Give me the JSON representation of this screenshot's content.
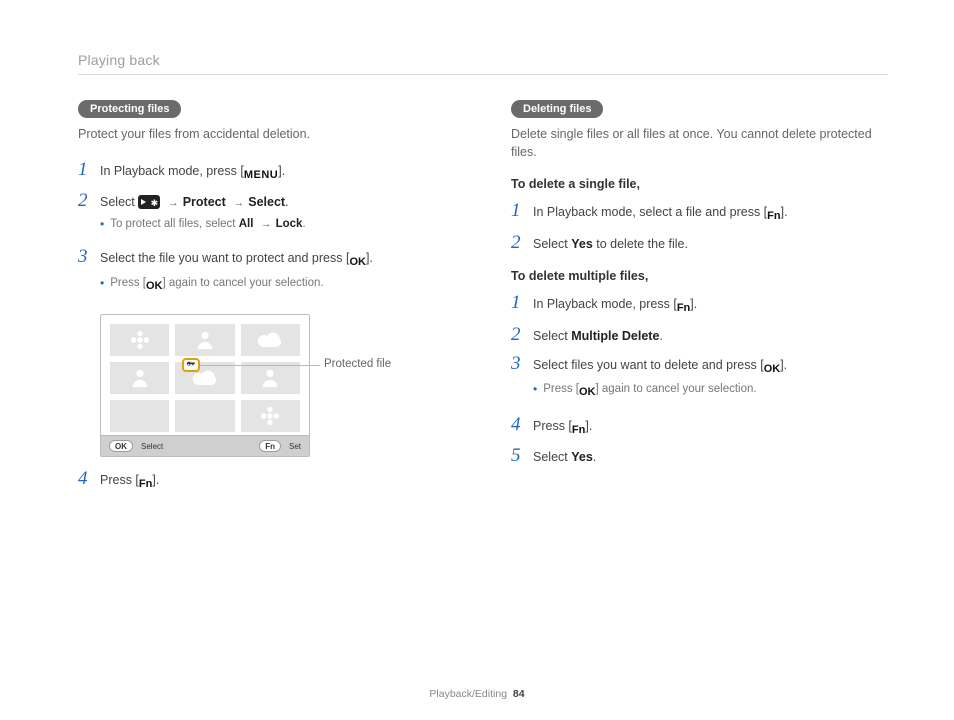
{
  "header": {
    "title": "Playing back"
  },
  "footer": {
    "section": "Playback/Editing",
    "page": "84"
  },
  "left": {
    "pill": "Protecting files",
    "intro": "Protect your files from accidental deletion.",
    "steps": [
      {
        "num": "1",
        "pre": "In Playback mode, press [",
        "icon": "MENU",
        "post": "]."
      },
      {
        "num": "2",
        "pre": "Select ",
        "icon": "video-gear",
        "chain1": "Protect",
        "chain2": "Select",
        "post": ".",
        "bullets": [
          {
            "pre": "To protect all files, select ",
            "b1": "All",
            "b2": "Lock",
            "post": "."
          }
        ]
      },
      {
        "num": "3",
        "pre": "Select the file you want to protect and press [",
        "icon": "OK",
        "post": "].",
        "bullets": [
          {
            "pre": "Press [",
            "icon": "OK",
            "post": "] again to cancel your selection."
          }
        ]
      },
      {
        "num": "4",
        "pre": "Press [",
        "icon": "Fn",
        "post": "]."
      }
    ],
    "figure": {
      "footer_ok": "OK",
      "footer_ok_label": "Select",
      "footer_fn": "Fn",
      "footer_fn_label": "Set",
      "callout": "Protected file"
    }
  },
  "right": {
    "pill": "Deleting files",
    "intro": "Delete single files or all files at once. You cannot delete protected files.",
    "subhead_single": "To delete a single file,",
    "single_steps": [
      {
        "num": "1",
        "pre": "In Playback mode, select a file and press [",
        "icon": "Fn",
        "post": "]."
      },
      {
        "num": "2",
        "pre": "Select ",
        "b": "Yes",
        "post": " to delete the file."
      }
    ],
    "subhead_multi": "To delete multiple files,",
    "multi_steps": [
      {
        "num": "1",
        "pre": "In Playback mode, press [",
        "icon": "Fn",
        "post": "]."
      },
      {
        "num": "2",
        "pre": "Select ",
        "b": "Multiple Delete",
        "post": "."
      },
      {
        "num": "3",
        "pre": "Select files you want to delete and press [",
        "icon": "OK",
        "post": "].",
        "bullets": [
          {
            "pre": "Press [",
            "icon": "OK",
            "post": "] again to cancel your selection."
          }
        ]
      },
      {
        "num": "4",
        "pre": "Press [",
        "icon": "Fn",
        "post": "]."
      },
      {
        "num": "5",
        "pre": "Select ",
        "b": "Yes",
        "post": "."
      }
    ]
  },
  "icons": {
    "MENU": "MENU",
    "OK": "OK",
    "Fn": "Fn",
    "arrow": "→"
  }
}
